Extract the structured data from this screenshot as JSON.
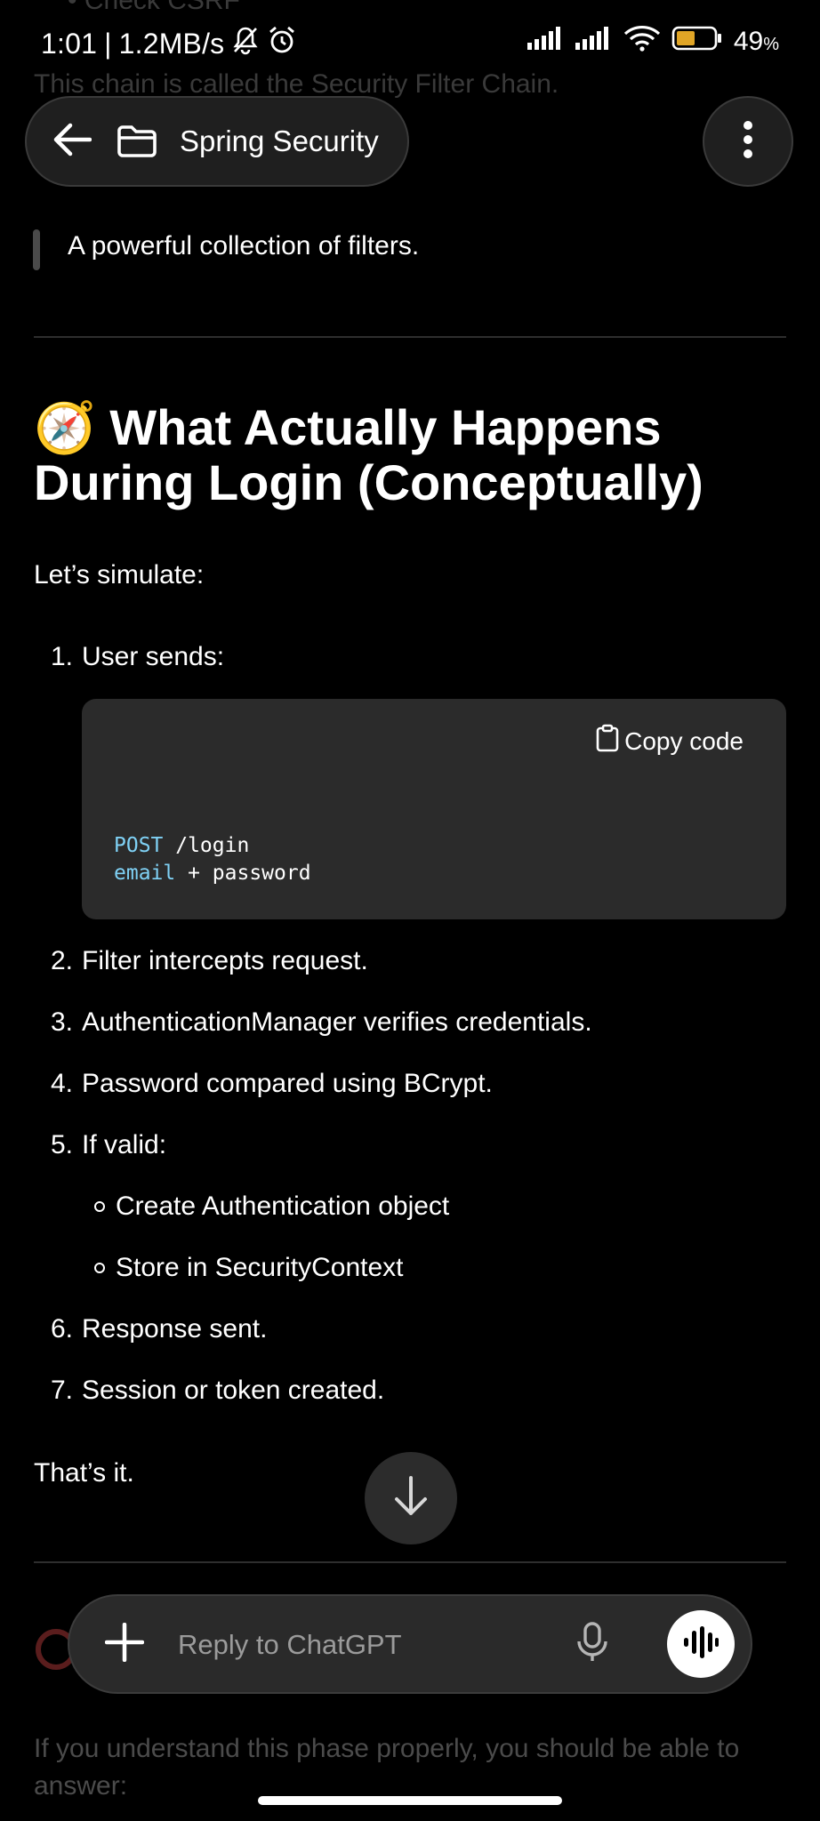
{
  "status_bar": {
    "time": "1:01",
    "speed": "1.2MB/s",
    "battery": "49",
    "battery_unit": "%",
    "battery_level": 0.49,
    "icons": [
      "mute-bell-icon",
      "alarm-icon",
      "signal-icon",
      "signal-icon",
      "wifi-icon",
      "battery-icon"
    ]
  },
  "ghost_text": {
    "top_bullet": "• Check CSRF",
    "chain_line": "This chain is called the Security Filter Chain."
  },
  "header": {
    "title": "Spring Security",
    "icons": [
      "back-arrow-icon",
      "folder-icon",
      "more-vertical-icon"
    ]
  },
  "content": {
    "quote": "A powerful collection of filters.",
    "heading_emoji": "🧭",
    "heading": "What Actually Happens During Login (Conceptually)",
    "intro": "Let’s simulate:",
    "steps": [
      {
        "num": "1.",
        "text": "User sends:"
      },
      {
        "num": "2.",
        "text": "Filter intercepts request."
      },
      {
        "num": "3.",
        "text": "AuthenticationManager verifies credentials."
      },
      {
        "num": "4.",
        "text": "Password compared using BCrypt."
      },
      {
        "num": "5.",
        "text": "If valid:"
      },
      {
        "num": "6.",
        "text": "Response sent."
      },
      {
        "num": "7.",
        "text": "Session or token created."
      }
    ],
    "sub_steps": [
      "Create Authentication object",
      "Store in SecurityContext"
    ],
    "code_block": {
      "copy_label": "Copy code",
      "line1_keyword": "POST",
      "line1_rest": " /login",
      "line2_keyword": "email",
      "line2_rest": " + password"
    },
    "outro": "That’s it.",
    "next_section_ghost": "If you understand this phase properly, you should be able to answer:"
  },
  "composer": {
    "placeholder": "Reply to ChatGPT",
    "icons": [
      "plus-icon",
      "microphone-icon",
      "voice-waveform-icon"
    ]
  },
  "scroll_button": {
    "icon": "arrow-down-icon"
  },
  "colors": {
    "background": "#000000",
    "surface": "#1f1f1f",
    "code_bg": "#2b2b2b",
    "code_keyword": "#7fd1f5",
    "battery_fill": "#e0a526"
  }
}
